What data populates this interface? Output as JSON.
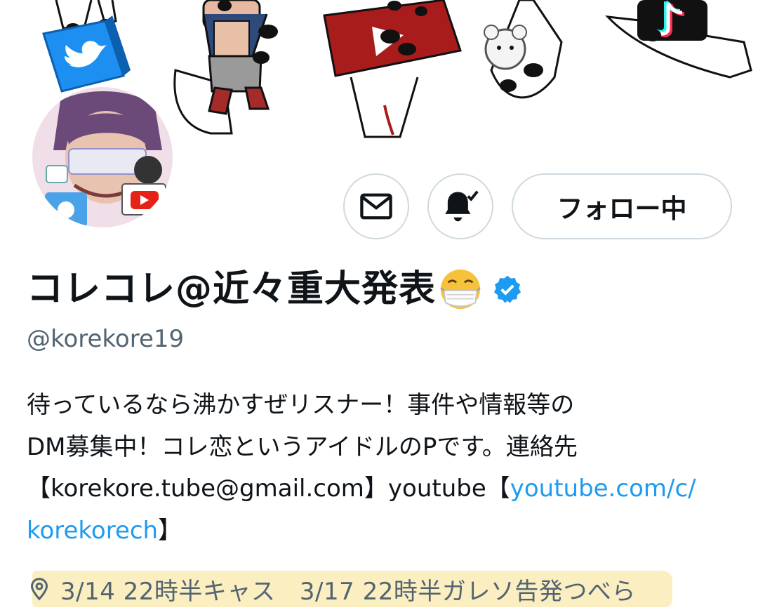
{
  "banner": {
    "items": [
      "twitter-logo",
      "chibi-figure",
      "youtube-logo",
      "teddy-bear",
      "tiktok-logo"
    ]
  },
  "actions": {
    "message_icon": "mail-icon",
    "notify_icon": "bell-check-icon",
    "follow_label": "フォロー中"
  },
  "profile": {
    "display_name": "コレコレ@近々重大発表",
    "handle": "@korekore19",
    "verified": true,
    "emoji": "face-with-medical-mask"
  },
  "bio": {
    "line1": "待っているなら沸かすぜリスナー！事件や情報等の",
    "line2": "DM募集中！コレ恋というアイドルのPです。連絡先",
    "line3_text": "【korekore.tube@gmail.com】youtube【",
    "line3_link": "youtube.com/c/",
    "line4_link": "korekorech",
    "line4_text": "】"
  },
  "location": {
    "icon": "location-pin-icon",
    "text": "3/14 22時半キャス　3/17 22時半ガレソ告発つべら"
  },
  "colors": {
    "link": "#1d9bf0",
    "secondary_text": "#536471",
    "border": "#cfd9de",
    "highlight": "#fbeec1",
    "verified": "#1d9bf0"
  }
}
